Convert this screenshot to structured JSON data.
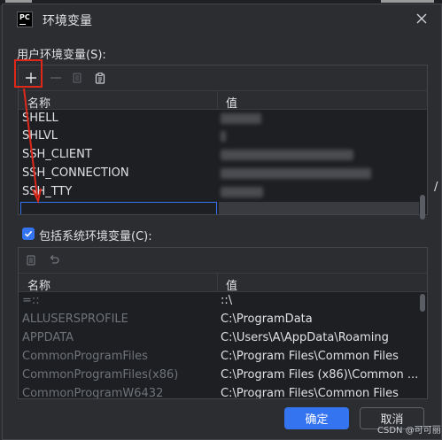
{
  "dialog": {
    "app_icon_text": "PC",
    "title": "环境变量"
  },
  "user_section": {
    "label": "用户环境变量(S):",
    "columns": {
      "name": "名称",
      "value": "值"
    },
    "rows": [
      {
        "name": "SHELL",
        "value": ""
      },
      {
        "name": "SHLVL",
        "value": ""
      },
      {
        "name": "SSH_CLIENT",
        "value": ""
      },
      {
        "name": "SSH_CONNECTION",
        "value": ""
      },
      {
        "name": "SSH_TTY",
        "value": ""
      }
    ],
    "new_row_name": "",
    "new_row_value": ""
  },
  "system_section": {
    "include_label": "包括系统环境变量(C):",
    "include_checked": true,
    "columns": {
      "name": "名称",
      "value": "值"
    },
    "rows": [
      {
        "name": "=::",
        "value": "::\\"
      },
      {
        "name": "ALLUSERSPROFILE",
        "value": "C:\\ProgramData"
      },
      {
        "name": "APPDATA",
        "value": "C:\\Users\\A\\AppData\\Roaming"
      },
      {
        "name": "CommonProgramFiles",
        "value": "C:\\Program Files\\Common Files"
      },
      {
        "name": "CommonProgramFiles(x86)",
        "value": "C:\\Program Files (x86)\\Common ..."
      },
      {
        "name": "CommonProgramW6432",
        "value": "C:\\Program Files\\Common Files"
      }
    ]
  },
  "buttons": {
    "ok": "确定",
    "cancel": "取消"
  },
  "watermark": "CSDN @可可丽",
  "accent_color": "#3574f0",
  "annotation_color": "#e0281a"
}
